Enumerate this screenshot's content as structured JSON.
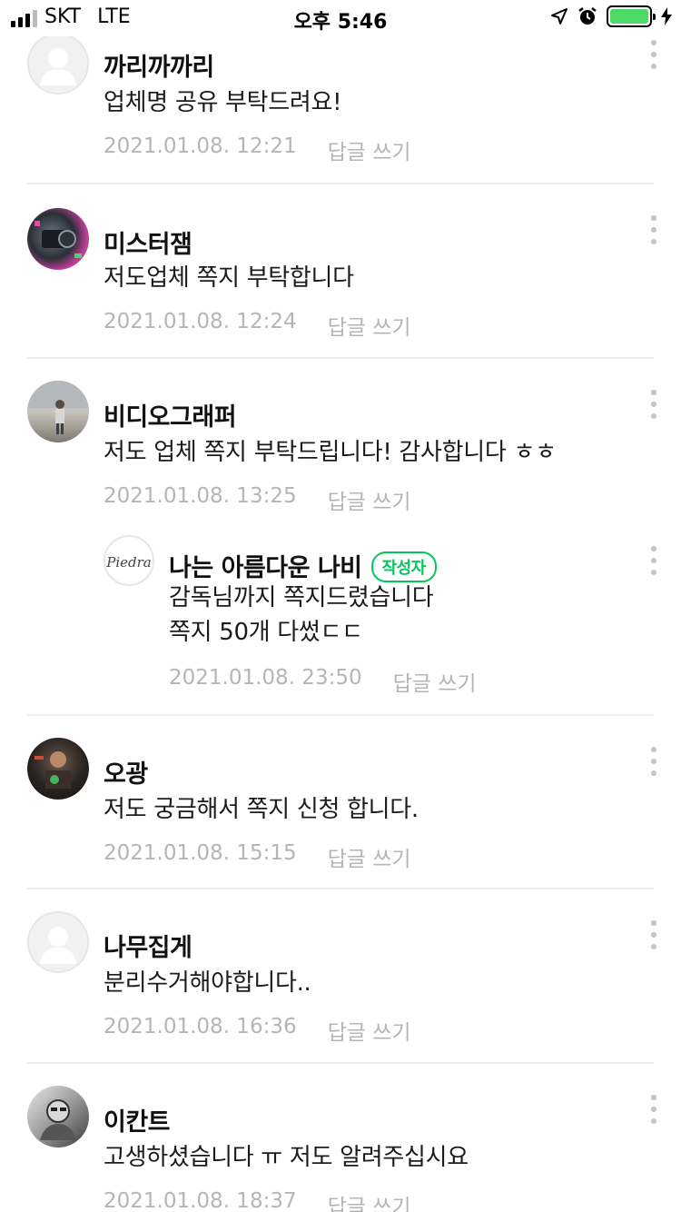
{
  "status_bar": {
    "carrier": "SKT",
    "network": "LTE",
    "time": "오후 5:46",
    "battery_color": "#4cd964"
  },
  "reply_label": "답글 쓰기",
  "author_badge": "작성자",
  "comments": [
    {
      "name": "까리까까리",
      "text": "업체명 공유 부탁드려요!",
      "date": "2021.01.08. 12:21",
      "avatar": "default"
    },
    {
      "name": "미스터잼",
      "text": "저도업체 쪽지 부탁합니다",
      "date": "2021.01.08. 12:24",
      "avatar": "photo"
    },
    {
      "name": "비디오그래퍼",
      "text": "저도 업체 쪽지 부탁드립니다! 감사합니다 ㅎㅎ",
      "date": "2021.01.08. 13:25",
      "avatar": "photo"
    },
    {
      "name": "나는 아름다운 나비",
      "text_line1": "감독님까지 쪽지드렸습니다",
      "text_line2": "쪽지 50개 다썼ㄷㄷ",
      "date": "2021.01.08. 23:50",
      "avatar": "logo",
      "avatar_logo_text": "Piedra",
      "is_author": true,
      "is_reply": true
    },
    {
      "name": "오광",
      "text": "저도 궁금해서 쪽지 신청 합니다.",
      "date": "2021.01.08. 15:15",
      "avatar": "photo"
    },
    {
      "name": "나무집게",
      "text": "분리수거해야합니다..",
      "date": "2021.01.08. 16:36",
      "avatar": "default"
    },
    {
      "name": "이칸트",
      "text": "고생하셨습니다 ㅠ 저도 알려주십시요",
      "date": "2021.01.08. 18:37",
      "avatar": "photo"
    }
  ],
  "colors": {
    "accent_green": "#03c75a",
    "meta_gray": "#b5b5b5",
    "divider": "#eeeeee"
  }
}
